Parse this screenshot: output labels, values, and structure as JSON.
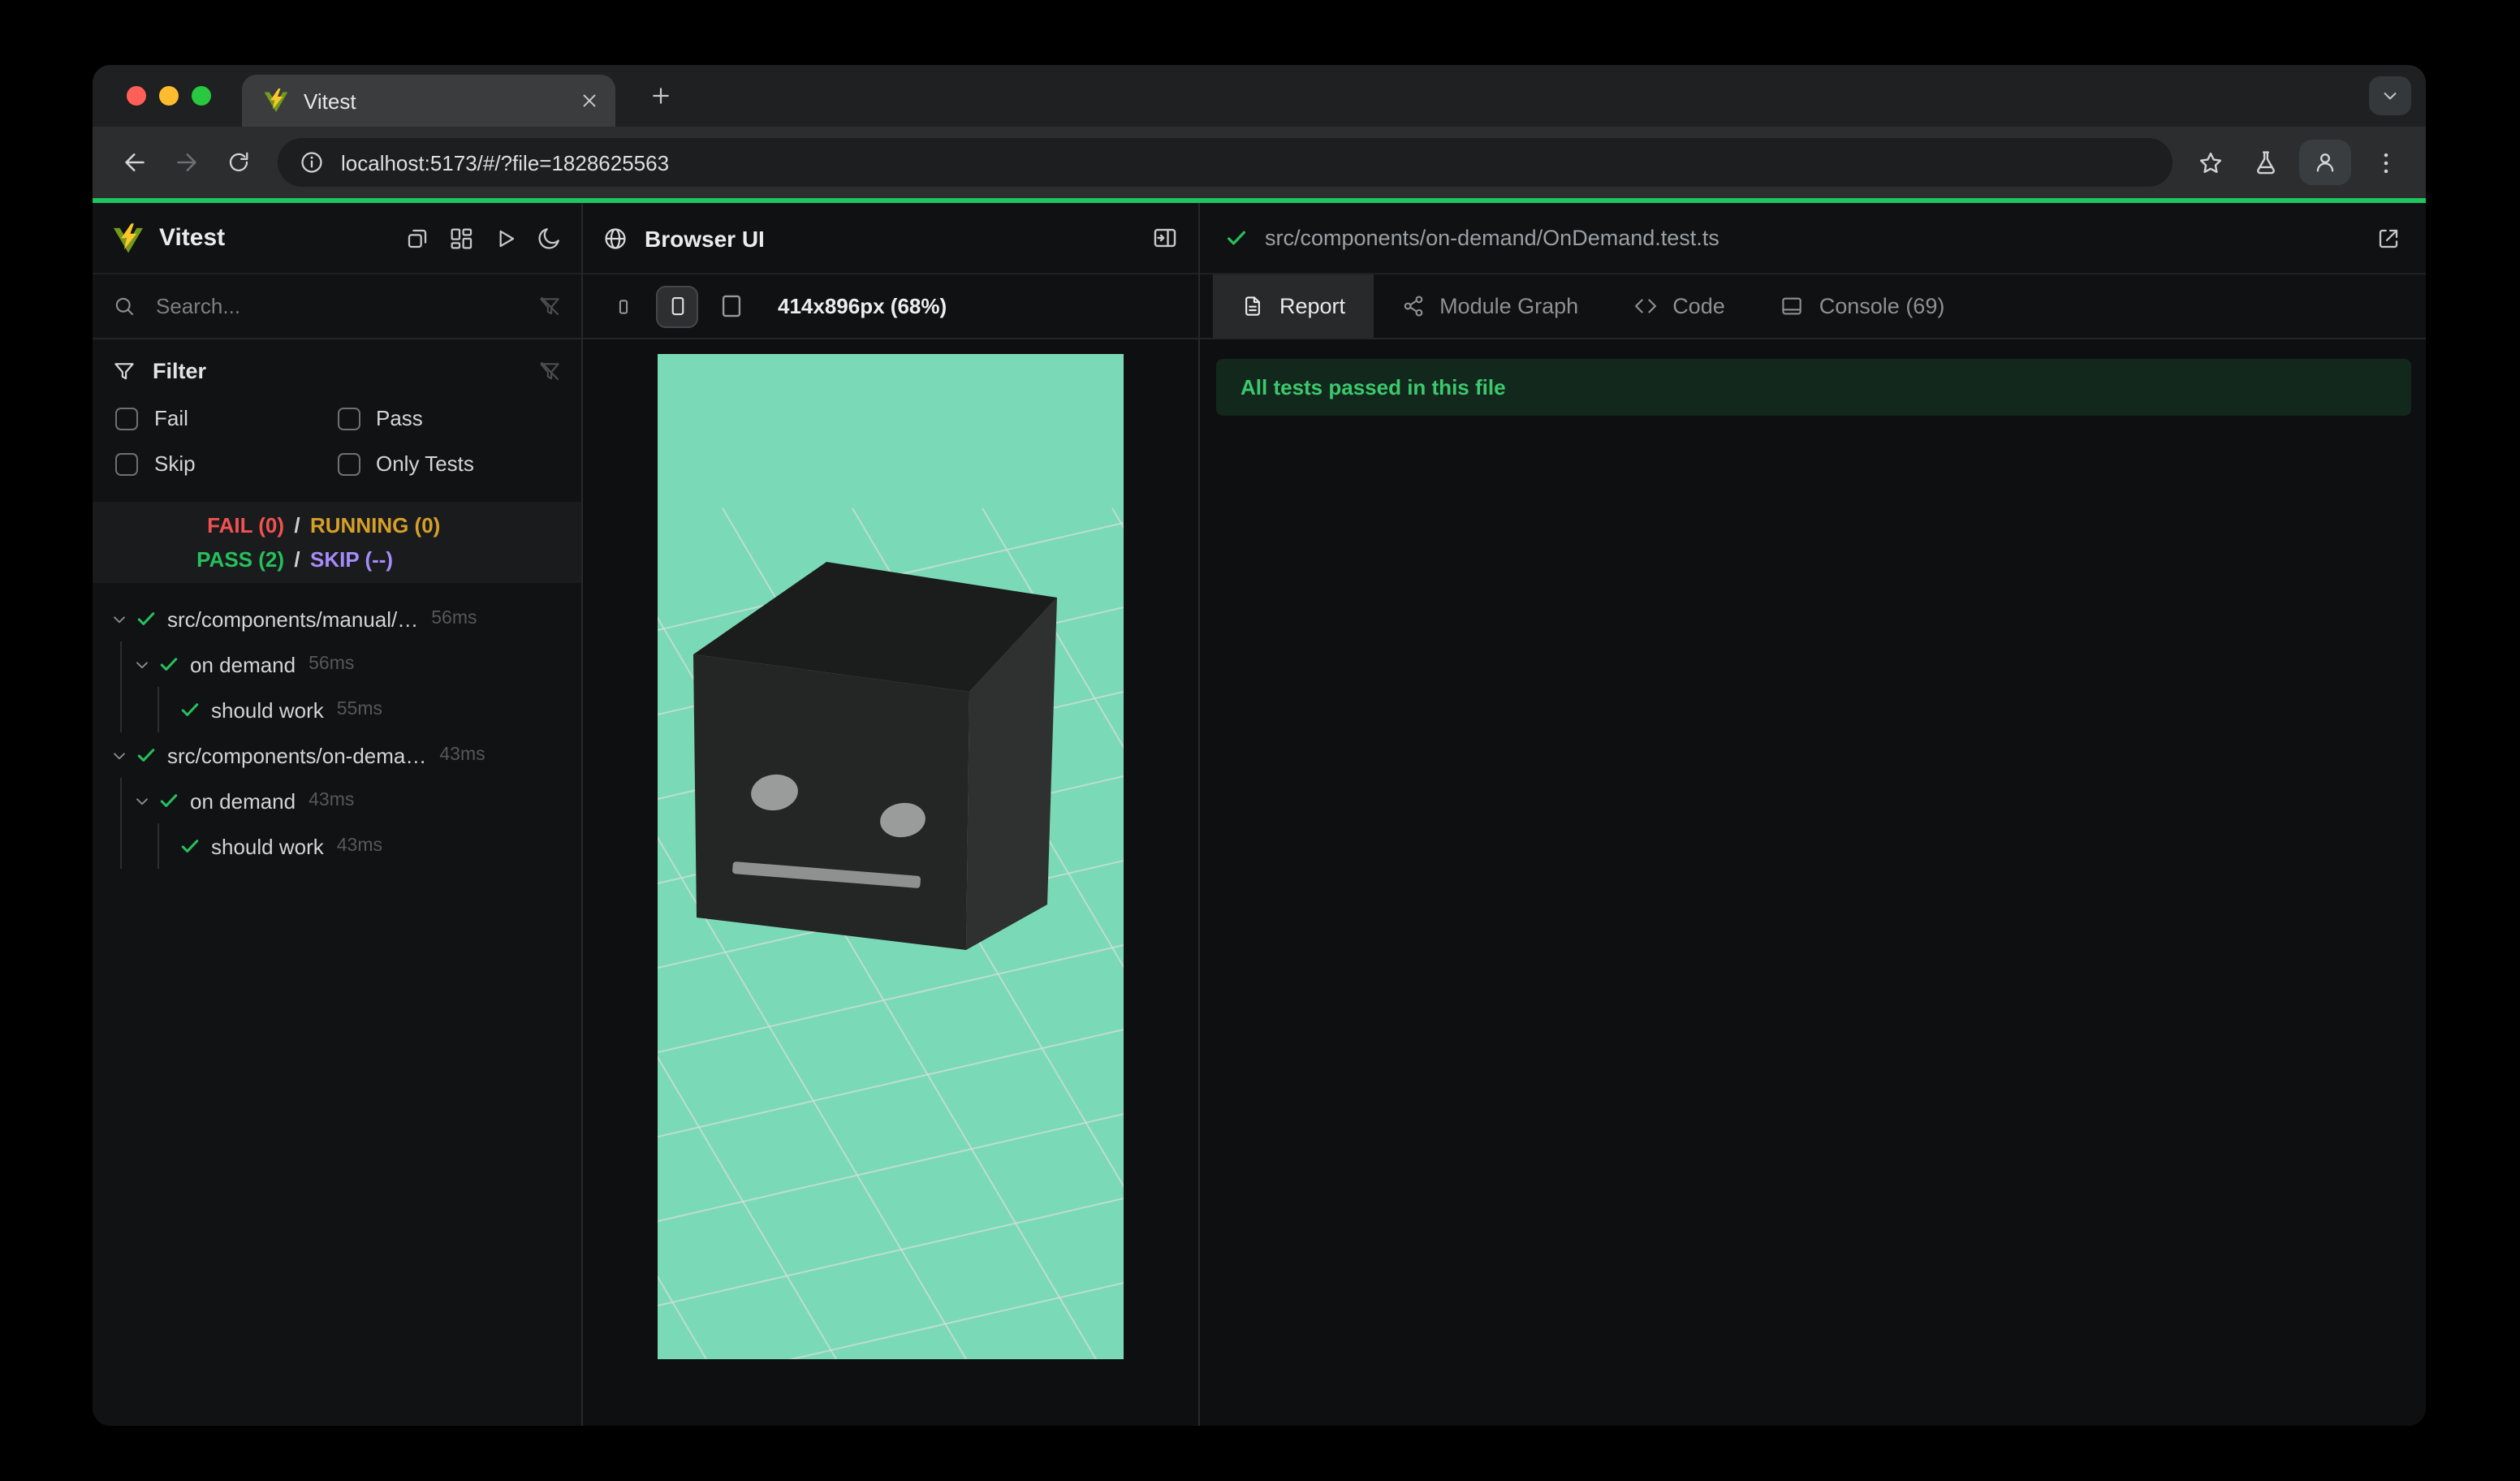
{
  "chrome": {
    "tab_title": "Vitest",
    "url": "localhost:5173/#/?file=1828625563"
  },
  "sidebar": {
    "app_name": "Vitest",
    "search_placeholder": "Search...",
    "filter_title": "Filter",
    "filters": {
      "fail": "Fail",
      "pass": "Pass",
      "skip": "Skip",
      "only_tests": "Only Tests"
    },
    "status": {
      "fail": "FAIL (0)",
      "running": "RUNNING (0)",
      "pass": "PASS (2)",
      "skip": "SKIP (--)",
      "separator": "/"
    },
    "tree": [
      {
        "label": "src/components/manual/…",
        "duration": "56ms"
      },
      {
        "label": "on demand",
        "duration": "56ms"
      },
      {
        "label": "should work",
        "duration": "55ms"
      },
      {
        "label": "src/components/on-dema…",
        "duration": "43ms"
      },
      {
        "label": "on demand",
        "duration": "43ms"
      },
      {
        "label": "should work",
        "duration": "43ms"
      }
    ]
  },
  "preview": {
    "title": "Browser UI",
    "viewport_label": "414x896px (68%)"
  },
  "report": {
    "file_path": "src/components/on-demand/OnDemand.test.ts",
    "tabs": {
      "report": "Report",
      "module_graph": "Module Graph",
      "code": "Code",
      "console": "Console (69)"
    },
    "banner": "All tests passed in this file"
  },
  "colors": {
    "accent_green": "#1fc55e",
    "fail_red": "#f05252",
    "running_yellow": "#d6a028",
    "pass_green": "#25c05c",
    "skip_purple": "#a78bfa",
    "viewport_mint": "#7adab7"
  }
}
